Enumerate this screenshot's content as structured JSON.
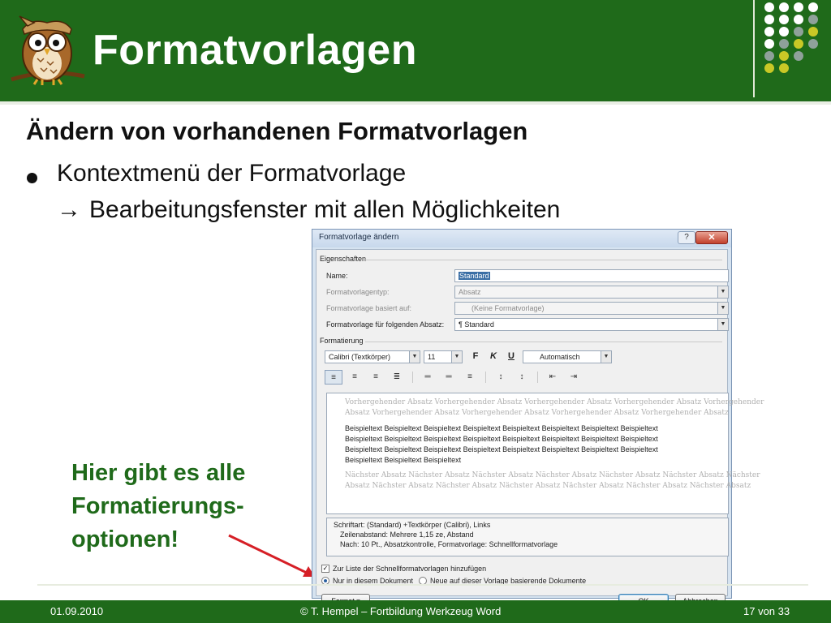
{
  "slide": {
    "title": "Formatvorlagen",
    "subtitle": "Ändern von vorhandenen Formatvorlagen",
    "bullet": "Kontextmenü der Formatvorlage",
    "bullet_sub_arrow": "→",
    "bullet_sub": "Bearbeitungsfenster mit allen Möglichkeiten",
    "callout_lines": [
      "Hier gibt es alle",
      "Formatierungs-",
      "optionen!"
    ]
  },
  "footer": {
    "date": "01.09.2010",
    "center": "© T. Hempel – Fortbildung Werkzeug Word",
    "page": "17 von 33"
  },
  "colors": {
    "header_green": "#1f6a1a",
    "dot_white": "#ffffff",
    "dot_grey": "#8fa19a",
    "dot_yellow": "#c9c826",
    "callout_green": "#1f6a1a",
    "arrow_red": "#d61f26"
  },
  "icons": {
    "logo": "owl-icon",
    "arrow": "right-arrow-icon"
  },
  "dialog": {
    "title": "Formatvorlage ändern",
    "help_label": "?",
    "close_label": "✕",
    "properties_heading": "Eigenschaften",
    "name_label": "Name:",
    "name_value": "Standard",
    "type_label": "Formatvorlagentyp:",
    "type_value": "Absatz",
    "based_label": "Formatvorlage basiert auf:",
    "based_value": "(Keine Formatvorlage)",
    "next_label": "Formatvorlage für folgenden Absatz:",
    "next_value": "¶ Standard",
    "formatting_heading": "Formatierung",
    "font_value": "Calibri (Textkörper)",
    "size_value": "11",
    "bold_label": "F",
    "italic_label": "K",
    "underline_label": "U",
    "color_value": "Automatisch",
    "preview_before": [
      "Vorhergehender Absatz Vorhergehender Absatz Vorhergehender Absatz Vorhergehender Absatz Vorhergehender",
      "Absatz Vorhergehender Absatz Vorhergehender Absatz Vorhergehender Absatz Vorhergehender Absatz"
    ],
    "preview_main": [
      "Beispieltext Beispieltext Beispieltext Beispieltext Beispieltext Beispieltext Beispieltext Beispieltext",
      "Beispieltext Beispieltext Beispieltext Beispieltext Beispieltext Beispieltext Beispieltext Beispieltext",
      "Beispieltext Beispieltext Beispieltext Beispieltext Beispieltext Beispieltext Beispieltext Beispieltext",
      "Beispieltext Beispieltext Beispieltext"
    ],
    "preview_after": [
      "Nächster Absatz Nächster Absatz Nächster Absatz Nächster Absatz Nächster Absatz Nächster Absatz Nächster",
      "Absatz Nächster Absatz Nächster Absatz Nächster Absatz Nächster Absatz Nächster Absatz Nächster Absatz"
    ],
    "description": [
      "Schriftart: (Standard) +Textkörper (Calibri), Links",
      "Zeilenabstand:  Mehrere 1,15 ze, Abstand",
      "Nach:  10 Pt., Absatzkontrolle, Formatvorlage: Schnellformatvorlage"
    ],
    "checkbox_label": "Zur Liste der Schnellformatvorlagen hinzufügen",
    "checkbox_checked": true,
    "radio_doc_label": "Nur in diesem Dokument",
    "radio_template_label": "Neue auf dieser Vorlage basierende Dokumente",
    "format_button": "Format ▾",
    "ok_button": "OK",
    "cancel_button": "Abbrechen"
  }
}
